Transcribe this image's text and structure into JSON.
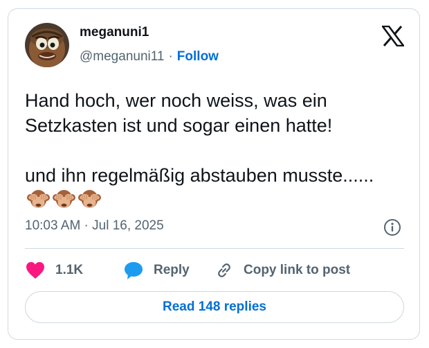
{
  "author": {
    "display_name": "meganuni1",
    "handle": "@meganuni11",
    "separator": "·",
    "follow_label": "Follow"
  },
  "tweet": {
    "paragraphs": [
      "Hand hoch, wer noch weiss, was ein Setzkasten ist und sogar einen hatte!",
      "und ihn regelmäßig abstauben musste......"
    ],
    "emojis": [
      "see-no-evil-monkey",
      "see-no-evil-monkey",
      "see-no-evil-monkey"
    ],
    "timestamp": "10:03 AM · Jul 16, 2025"
  },
  "actions": {
    "likes_count": "1.1K",
    "reply_label": "Reply",
    "copy_link_label": "Copy link to post"
  },
  "footer": {
    "read_replies_label": "Read 148 replies"
  },
  "icons": {
    "brand": "x-logo",
    "info": "info-icon",
    "like": "heart-icon",
    "reply": "speech-bubble-icon",
    "copy_link": "link-icon"
  },
  "colors": {
    "text_primary": "#0f1419",
    "text_secondary": "#536471",
    "link_blue": "#006fd6",
    "heart_pink": "#f91880",
    "reply_blue": "#1d9bf0",
    "border": "#cfd9de"
  }
}
